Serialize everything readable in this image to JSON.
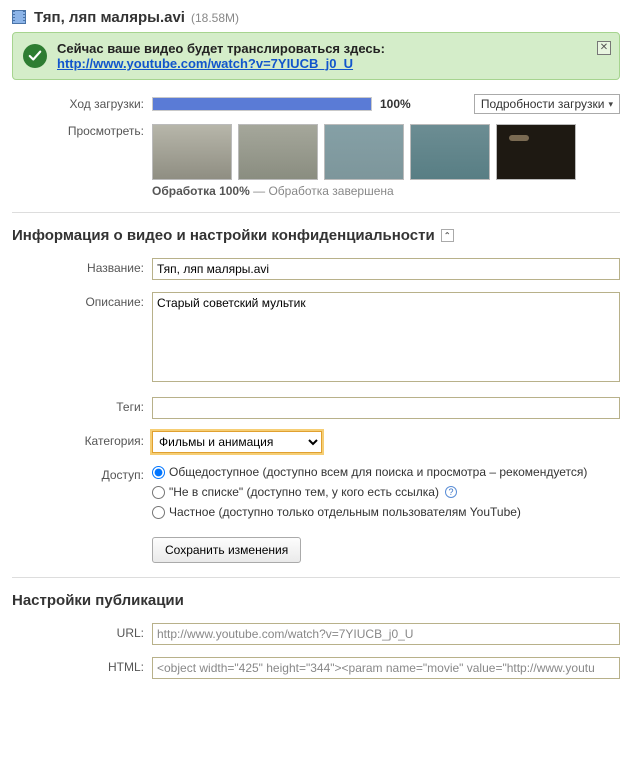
{
  "header": {
    "title": "Тяп, ляп маляры.avi",
    "size": "(18.58M)"
  },
  "success": {
    "text": "Сейчас ваше видео будет транслироваться здесь:",
    "link": "http://www.youtube.com/watch?v=7YIUCB_j0_U"
  },
  "upload": {
    "progress_label": "Ход загрузки:",
    "percent": "100%",
    "details_label": "Подробности загрузки"
  },
  "preview": {
    "label": "Просмотреть:",
    "processing_bold": "Обработка 100%",
    "processing_rest": " — Обработка завершена"
  },
  "section_info_title": "Информация о видео и настройки конфиденциальности",
  "form": {
    "name_label": "Название:",
    "name_value": "Тяп, ляп маляры.avi",
    "desc_label": "Описание:",
    "desc_value": "Старый советский мультик",
    "tags_label": "Теги:",
    "tags_value": "",
    "cat_label": "Категория:",
    "cat_value": "Фильмы и анимация",
    "access_label": "Доступ:",
    "access_options": {
      "public": "Общедоступное (доступно всем для поиска и просмотра – рекомендуется)",
      "unlisted": "\"Не в списке\" (доступно тем, у кого есть ссылка)",
      "private": "Частное (доступно только отдельным пользователям YouTube)"
    },
    "save_label": "Сохранить изменения"
  },
  "publish": {
    "title": "Настройки публикации",
    "url_label": "URL:",
    "url_value": "http://www.youtube.com/watch?v=7YIUCB_j0_U",
    "html_label": "HTML:",
    "html_value": "<object width=\"425\" height=\"344\"><param name=\"movie\" value=\"http://www.youtu"
  }
}
